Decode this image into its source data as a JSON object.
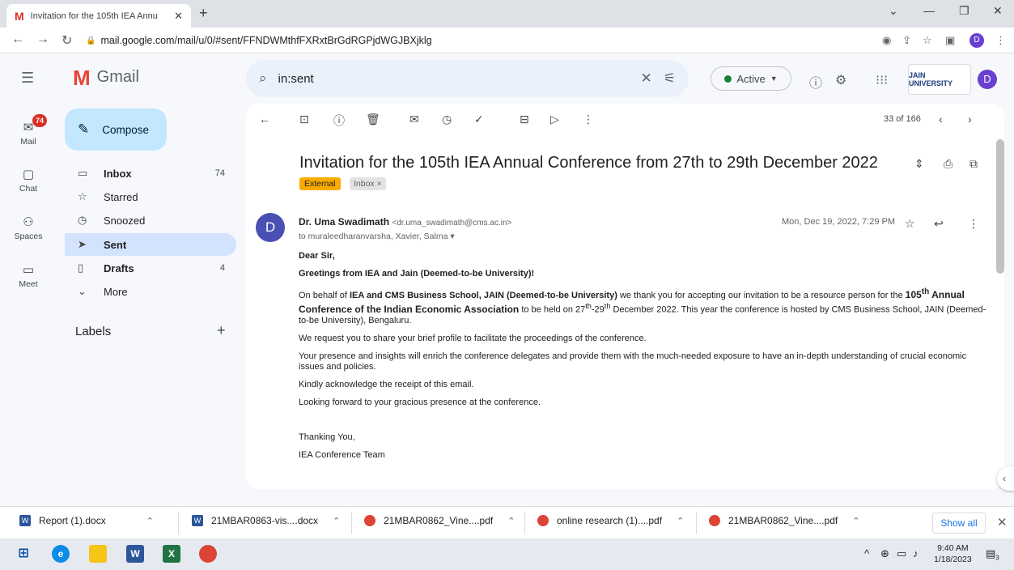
{
  "browser": {
    "tab_title": "Invitation for the 105th IEA Annu",
    "tab_favicon": "M",
    "url": "mail.google.com/mail/u/0/#sent/FFNDWMthfFXRxtBrGdRGPjdWGJBXjklg",
    "profile_initial": "D"
  },
  "gmail": {
    "logo_text": "Gmail",
    "search_query": "in:sent",
    "status": "Active",
    "org_logo_text": "JAIN UNIVERSITY",
    "avatar_initial": "D"
  },
  "rail": {
    "badge": "74",
    "items": [
      "Mail",
      "Chat",
      "Spaces",
      "Meet"
    ]
  },
  "nav": {
    "compose": "Compose",
    "items": [
      {
        "label": "Inbox",
        "count": "74"
      },
      {
        "label": "Starred",
        "count": ""
      },
      {
        "label": "Snoozed",
        "count": ""
      },
      {
        "label": "Sent",
        "count": ""
      },
      {
        "label": "Drafts",
        "count": "4"
      },
      {
        "label": "More",
        "count": ""
      }
    ],
    "labels_header": "Labels"
  },
  "message": {
    "page_count": "33 of 166",
    "subject": "Invitation for the 105th IEA Annual Conference from 27th to 29th December 2022",
    "tag_external": "External",
    "tag_inbox": "Inbox ×",
    "sender_initial": "D",
    "sender_name": "Dr. Uma Swadimath",
    "sender_email": "<dr.uma_swadimath@cms.ac.in>",
    "recipients": "to muraleedharanvarsha, Xavier, Salma ▾",
    "date": "Mon, Dec 19, 2022, 7:29 PM",
    "salutation": "Dear Sir,",
    "greeting": "Greetings from IEA and Jain (Deemed-to-be University)!",
    "p1_a": "On behalf of ",
    "p1_b": "IEA and CMS Business School, JAIN (Deemed-to-be University)",
    "p1_c": " we thank you for accepting our invitation to be a resource person for the ",
    "p1_d": "105",
    "p1_e": "th",
    "p1_f": " Annual Conference of the Indian Economic Association",
    "p1_g": " to be held on 27",
    "p1_h": "th",
    "p1_i": "-29",
    "p1_j": "th",
    "p1_k": " December 2022. This year the conference is hosted by CMS Business School, JAIN (Deemed-to-be University), Bengaluru.",
    "p2": "We request you to share your brief profile to facilitate the proceedings of the conference.",
    "p3": "Your presence and insights will enrich the conference delegates and provide them with the much-needed exposure to have an in-depth understanding of crucial economic issues and policies.",
    "p4": "Kindly acknowledge the receipt of this email.",
    "p5": "Looking forward to your gracious presence at the conference.",
    "closing": "Thanking You,",
    "signature": "IEA Conference Team"
  },
  "downloads": {
    "items": [
      "Report (1).docx",
      "21MBAR0863-vis....docx",
      "21MBAR0862_Vine....pdf",
      "online research (1)....pdf",
      "21MBAR0862_Vine....pdf"
    ],
    "show_all": "Show all"
  },
  "taskbar": {
    "time": "9:40 AM",
    "date": "1/18/2023",
    "notif_count": "3"
  }
}
